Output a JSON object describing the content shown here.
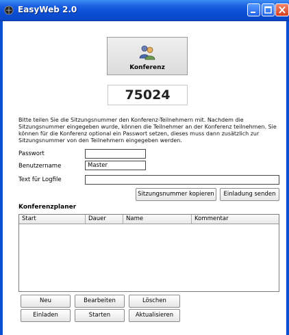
{
  "window": {
    "title": "EasyWeb 2.0"
  },
  "conference_button": {
    "label": "Konferenz"
  },
  "session_number": "75024",
  "info_text": "Bitte teilen Sie die Sitzungsnummer den Konferenz-Teilnehmern mit. Nachdem die Sitzungsnummer eingegeben wurde, können die Teilnehmer an der Konferenz teilnehmen. Sie können für die Konferenz optional ein Passwort setzen, dieses muss dann zusätzlich zur Sitzungsnummer von den Teilnehmern eingegeben werden.",
  "form": {
    "password_label": "Passwort",
    "password_value": "",
    "username_label": "Benutzername",
    "username_value": "Master",
    "logfile_label": "Text für Logfile",
    "logfile_value": ""
  },
  "actions": {
    "copy_session": "Sitzungsnummer kopieren",
    "send_invite": "Einladung senden"
  },
  "planner": {
    "title": "Konferenzplaner",
    "columns": [
      "Start",
      "Dauer",
      "Name",
      "Kommentar"
    ],
    "rows": []
  },
  "planner_buttons": {
    "new": "Neu",
    "edit": "Bearbeiten",
    "delete": "Löschen",
    "invite": "Einladen",
    "start": "Starten",
    "refresh": "Aktualisieren"
  },
  "colors": {
    "titlebar": "#0b4fd6",
    "close_button": "#d4401c"
  },
  "icons": {
    "app": "globe-app-icon",
    "conference": "people-icon"
  }
}
